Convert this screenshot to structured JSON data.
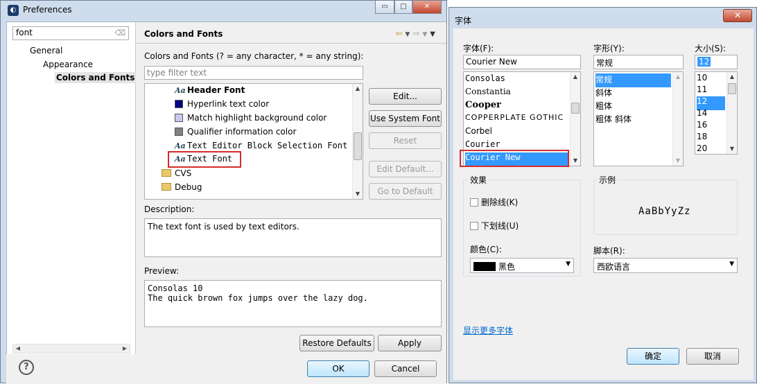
{
  "preferences": {
    "title": "Preferences",
    "window_buttons": {
      "minimize": "▭",
      "maximize": "□",
      "close": "✕"
    },
    "filter": {
      "value": "font"
    },
    "tree": [
      {
        "label": "General"
      },
      {
        "label": "Appearance"
      },
      {
        "label": "Colors and Fonts"
      }
    ],
    "section_title": "Colors and Fonts",
    "filter_hint": "Colors and Fonts (? = any character, * = any string):",
    "type_filter_placeholder": "type filter text",
    "list": [
      {
        "label": "Header Font",
        "icon": "font-icon",
        "bold": true
      },
      {
        "label": "Hyperlink text color",
        "icon": "color-swatch-icon",
        "color": "#000080"
      },
      {
        "label": "Match highlight background color",
        "icon": "color-swatch-icon",
        "color": "#c8c8f0"
      },
      {
        "label": "Qualifier information color",
        "icon": "color-swatch-icon",
        "color": "#808080"
      },
      {
        "label": "Text Editor Block Selection Font",
        "icon": "font-icon",
        "mono": true
      },
      {
        "label": "Text Font",
        "icon": "font-icon",
        "mono": true
      },
      {
        "label": "CVS",
        "icon": "folder-icon"
      },
      {
        "label": "Debug",
        "icon": "folder-icon"
      }
    ],
    "buttons": {
      "edit": "Edit...",
      "use_system_font": "Use System Font",
      "reset": "Reset",
      "edit_default": "Edit Default...",
      "go_to_default": "Go to Default",
      "restore_defaults": "Restore Defaults",
      "apply": "Apply",
      "ok": "OK",
      "cancel": "Cancel"
    },
    "description_label": "Description:",
    "description_text": "The text font is used by text editors.",
    "preview_label": "Preview:",
    "preview_line1": "Consolas 10",
    "preview_line2": "The quick brown fox jumps over the lazy dog."
  },
  "font_dialog": {
    "title": "字体",
    "font_label": "字体(F):",
    "font_value": "Courier New",
    "fonts": [
      "Consolas",
      "Constantia",
      "Cooper",
      "COPPERPLATE GOTHIC",
      "Corbel",
      "Courier",
      "Courier New"
    ],
    "style_label": "字形(Y):",
    "style_value": "常规",
    "styles": [
      "常规",
      "斜体",
      "粗体",
      "粗体 斜体"
    ],
    "size_label": "大小(S):",
    "size_value": "12",
    "sizes": [
      "10",
      "11",
      "12",
      "14",
      "16",
      "18",
      "20"
    ],
    "effects_label": "效果",
    "strikeout_label": "删除线(K)",
    "underline_label": "下划线(U)",
    "color_label": "颜色(C):",
    "color_value": "黑色",
    "sample_label": "示例",
    "sample_text": "AaBbYyZz",
    "script_label": "脚本(R):",
    "script_value": "西欧语言",
    "more_fonts_link": "显示更多字体",
    "ok": "确定",
    "cancel": "取消"
  }
}
